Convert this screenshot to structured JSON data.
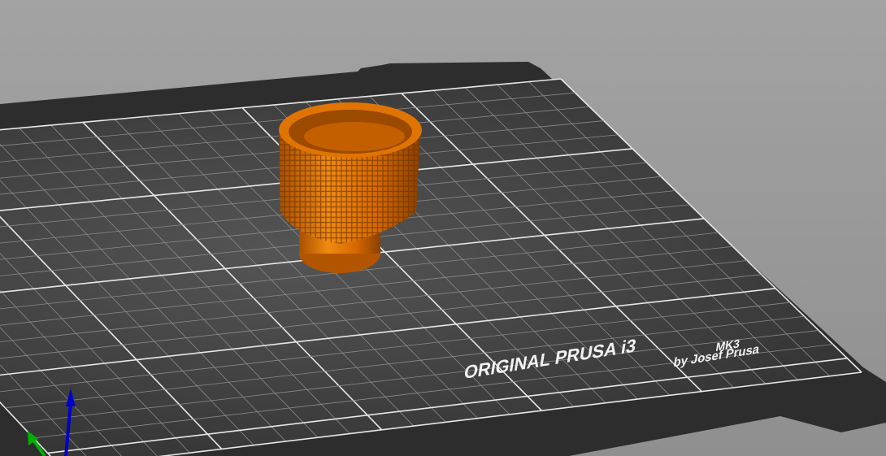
{
  "scene": {
    "background": "#9a9a9a",
    "bed_color": "#2e2e2e",
    "surface_color": "#3b3b3b",
    "object_color": "#d86a00",
    "bed_logo": {
      "title": "ORIGINAL PRUSA i3",
      "model": "MK3",
      "byline": "by Josef Prusa"
    },
    "bed_grid": {
      "minor_step_mm": 10,
      "major_step_mm": 50,
      "size_mm": [
        250,
        210
      ]
    },
    "axes": {
      "x_color": "#d00000",
      "y_color": "#00b000",
      "z_color": "#0000c8"
    }
  }
}
